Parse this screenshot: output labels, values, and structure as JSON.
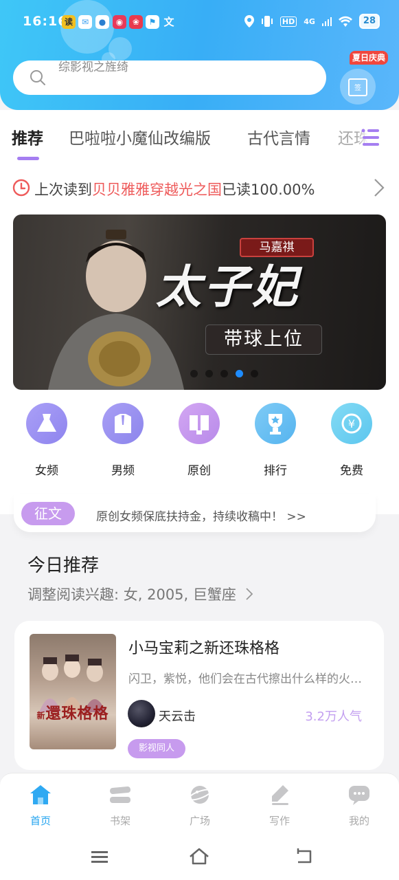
{
  "status": {
    "time": "16:16",
    "network": "4G",
    "battery": "28",
    "hd": "HD"
  },
  "search": {
    "placeholder": "综影视之旌绮"
  },
  "gift": {
    "badge": "夏日庆典",
    "label": "签"
  },
  "tabs": [
    {
      "label": "推荐",
      "active": true
    },
    {
      "label": "巴啦啦小魔仙改编版",
      "active": false
    },
    {
      "label": "古代言情",
      "active": false
    },
    {
      "label": "还珠",
      "active": false
    }
  ],
  "history": {
    "prefix": "上次读到",
    "book": "贝贝雅雅穿越光之国",
    "suffix": "已读100.00%"
  },
  "banner": {
    "title": "太子妃",
    "name": "马嘉祺",
    "subtitle": "带球上位",
    "dots": 5,
    "active_dot": 3
  },
  "categories": [
    {
      "label": "女频",
      "icon": "dress-icon",
      "color": "#9f95f5"
    },
    {
      "label": "男频",
      "icon": "shirt-icon",
      "color": "#9b93f2"
    },
    {
      "label": "原创",
      "icon": "book-icon",
      "color": "#c99af0"
    },
    {
      "label": "排行",
      "icon": "trophy-icon",
      "color": "#6cc1f4"
    },
    {
      "label": "免费",
      "icon": "coin-icon",
      "color": "#6fd0f2"
    }
  ],
  "notice": {
    "tag": "征文",
    "text": "原创女频保底扶持金，持续收稿中！ >>"
  },
  "recommend": {
    "title": "今日推荐",
    "interest": "调整阅读兴趣: 女, 2005, 巨蟹座"
  },
  "book": {
    "title": "小马宝莉之新还珠格格",
    "desc": "闪卫，紫悦，他们会在古代擦出什么样的火花呢",
    "author": "天云击",
    "popularity": "3.2万人气",
    "tag": "影视同人",
    "cover_title": "還珠格格",
    "cover_prefix": "新"
  },
  "bottom_nav": [
    {
      "label": "首页",
      "icon": "home-icon",
      "active": true
    },
    {
      "label": "书架",
      "icon": "bookshelf-icon",
      "active": false
    },
    {
      "label": "广场",
      "icon": "planet-icon",
      "active": false
    },
    {
      "label": "写作",
      "icon": "pen-icon",
      "active": false
    },
    {
      "label": "我的",
      "icon": "chat-icon",
      "active": false
    }
  ],
  "colors": {
    "accent": "#a57ef1",
    "header": "#38aef6",
    "highlight": "#ee5a5a",
    "nav_active": "#22a3ef"
  }
}
